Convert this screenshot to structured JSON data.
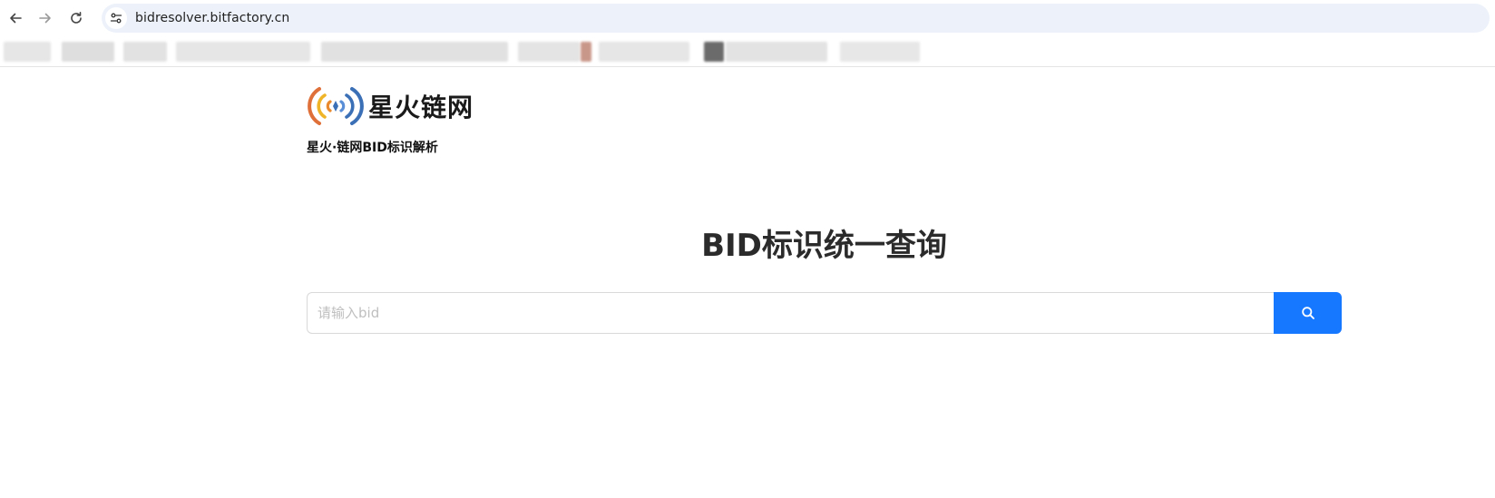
{
  "browser": {
    "url": "bidresolver.bitfactory.cn",
    "icons": {
      "back": "arrow-left-icon",
      "forward": "arrow-right-icon",
      "reload": "reload-icon",
      "site_info": "tune-icon"
    }
  },
  "header": {
    "logo_text": "星火链网",
    "subtitle": "星火·链网BID标识解析"
  },
  "main": {
    "heading": "BID标识统一查询",
    "search": {
      "placeholder": "请输入bid",
      "value": "",
      "button_icon": "search-icon"
    }
  },
  "colors": {
    "accent": "#1677ff",
    "logo_orange": "#e0703a",
    "logo_blue": "#3b6fb6",
    "logo_yellow": "#f0b429"
  }
}
